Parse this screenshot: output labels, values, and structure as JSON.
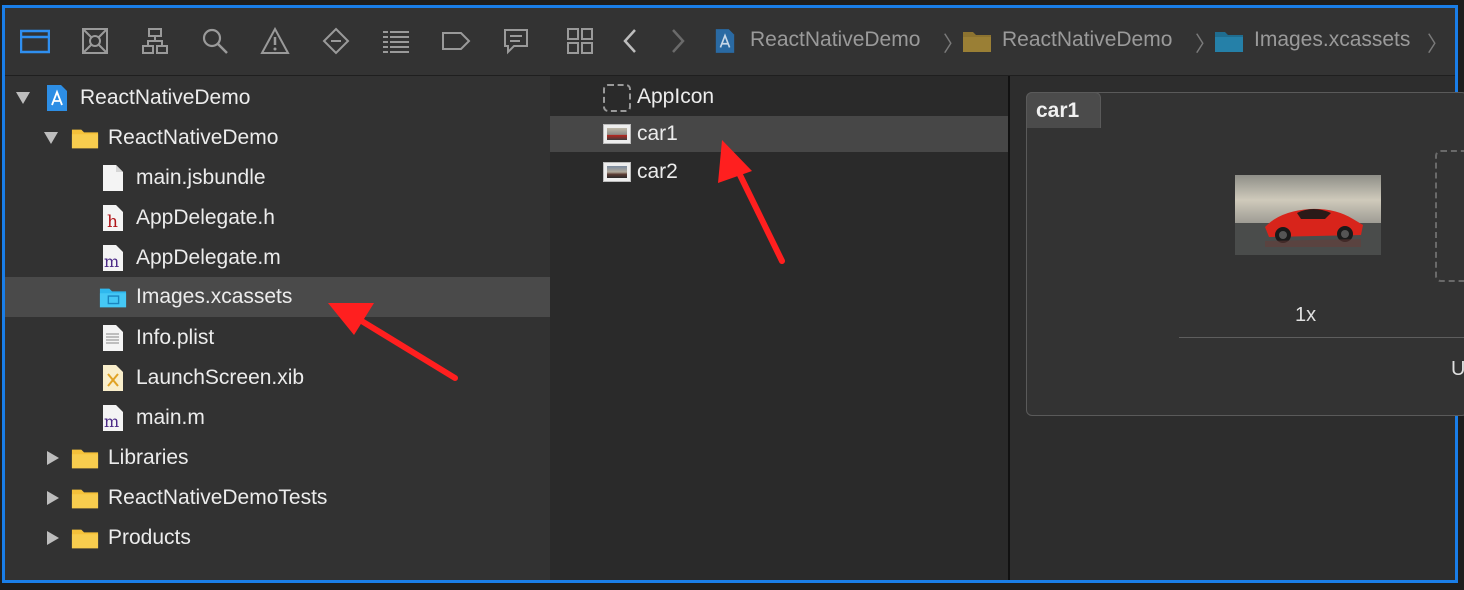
{
  "navigator": {
    "toolbar_icons": [
      "folder-icon",
      "source-control-icon",
      "hierarchy-icon",
      "search-icon",
      "warning-icon",
      "test-icon",
      "debug-icon",
      "breakpoint-icon",
      "report-icon"
    ],
    "tree": [
      {
        "label": "ReactNativeDemo",
        "level": 0,
        "icon": "project-icon",
        "disclosure": "expanded"
      },
      {
        "label": "ReactNativeDemo",
        "level": 1,
        "icon": "folder-icon",
        "disclosure": "expanded"
      },
      {
        "label": "main.jsbundle",
        "level": 2,
        "icon": "file-icon"
      },
      {
        "label": "AppDelegate.h",
        "level": 2,
        "icon": "header-file-icon"
      },
      {
        "label": "AppDelegate.m",
        "level": 2,
        "icon": "objc-file-icon"
      },
      {
        "label": "Images.xcassets",
        "level": 2,
        "icon": "asset-catalog-icon",
        "selected": true
      },
      {
        "label": "Info.plist",
        "level": 2,
        "icon": "plist-icon"
      },
      {
        "label": "LaunchScreen.xib",
        "level": 2,
        "icon": "xib-icon"
      },
      {
        "label": "main.m",
        "level": 2,
        "icon": "objc-file-icon"
      },
      {
        "label": "Libraries",
        "level": 1,
        "icon": "folder-icon",
        "disclosure": "collapsed"
      },
      {
        "label": "ReactNativeDemoTests",
        "level": 1,
        "icon": "folder-icon",
        "disclosure": "collapsed"
      },
      {
        "label": "Products",
        "level": 1,
        "icon": "folder-icon",
        "disclosure": "collapsed"
      }
    ]
  },
  "editor_toolbar": {
    "breadcrumbs": [
      "ReactNativeDemo",
      "ReactNativeDemo",
      "Images.xcassets"
    ]
  },
  "assets": [
    {
      "label": "AppIcon",
      "icon": "appicon-placeholder-icon"
    },
    {
      "label": "car1",
      "icon": "image-thumb-icon",
      "selected": true
    },
    {
      "label": "car2",
      "icon": "image-thumb-icon"
    }
  ],
  "detail": {
    "set_name": "car1",
    "slot_scale": "1x",
    "partial_label": "U"
  },
  "colors": {
    "accent": "#1a7ee8",
    "annotation_arrow": "#ff1f1f",
    "folder": "#f5c13a",
    "asset_folder": "#3ec3f2"
  }
}
